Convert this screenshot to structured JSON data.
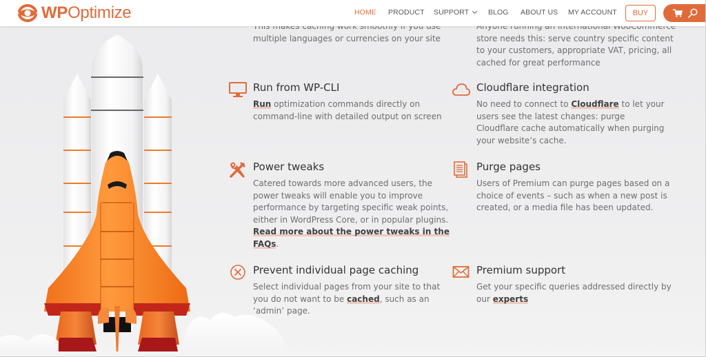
{
  "brand": {
    "name_bold": "WP",
    "name_light": "Optimize",
    "accent": "#e06b3a"
  },
  "nav": {
    "items": [
      {
        "label": "HOME",
        "active": true
      },
      {
        "label": "PRODUCT"
      },
      {
        "label": "SUPPORT",
        "has_dropdown": true
      },
      {
        "label": "BLOG"
      },
      {
        "label": "ABOUT US"
      },
      {
        "label": "MY ACCOUNT"
      }
    ],
    "buy_label": "BUY",
    "cart_icon": "cart-icon",
    "search_icon": "search-icon"
  },
  "partial_top": {
    "left_lines": [
      "This makes caching work smoothly if you use",
      "multiple languages or currencies on your site"
    ],
    "right_lines": [
      "Anyone running an international WooCommerce",
      "store needs this: serve country specific content",
      "to your customers, appropriate VAT, pricing, all",
      "cached for great performance"
    ]
  },
  "features": [
    {
      "icon": "monitor-icon",
      "title": "Run from WP-CLI",
      "desc": [
        {
          "text": "Run",
          "link": true
        },
        {
          "text": " optimization commands directly on command-line with detailed output on screen"
        }
      ]
    },
    {
      "icon": "cloud-icon",
      "title": "Cloudflare integration",
      "desc": [
        {
          "text": "No need to connect to "
        },
        {
          "text": "Cloudflare",
          "link": true
        },
        {
          "text": " to let your users see the latest changes: purge Cloudflare cache automatically when purging your website’s cache."
        }
      ]
    },
    {
      "icon": "tools-icon",
      "title": "Power tweaks",
      "desc": [
        {
          "text": "Catered towards more advanced users, the power tweaks will enable you to improve performance by targeting specific weak points, either in WordPress Core, or in popular plugins. "
        },
        {
          "text": "Read more about the power tweaks in the FAQs",
          "link": true
        },
        {
          "text": "."
        }
      ]
    },
    {
      "icon": "documents-icon",
      "title": "Purge pages",
      "desc": [
        {
          "text": "Users of Premium can purge pages based on a choice of events – such as when a new post is created, or a media file has been updated."
        }
      ]
    },
    {
      "icon": "circle-x-icon",
      "title": "Prevent individual page caching",
      "desc": [
        {
          "text": "Select individual pages from your site to that you do not want to be "
        },
        {
          "text": "cached",
          "link": true
        },
        {
          "text": ", such as an ‘admin’ page."
        }
      ]
    },
    {
      "icon": "envelope-icon",
      "title": "Premium support",
      "desc": [
        {
          "text": "Get your specific queries addressed directly by our "
        },
        {
          "text": "experts",
          "link": true
        }
      ]
    }
  ]
}
